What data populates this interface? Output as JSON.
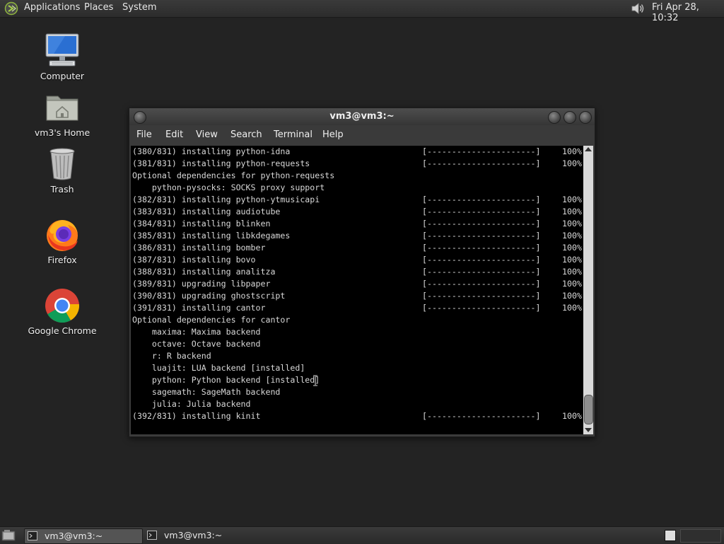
{
  "top_panel": {
    "menus": [
      "Applications",
      "Places",
      "System"
    ],
    "clock": "Fri Apr 28, 10:32"
  },
  "desktop_icons": [
    {
      "label": "Computer",
      "icon": "computer-icon"
    },
    {
      "label": "vm3's Home",
      "icon": "home-folder-icon"
    },
    {
      "label": "Trash",
      "icon": "trash-icon"
    },
    {
      "label": "Firefox",
      "icon": "firefox-icon"
    },
    {
      "label": "Google Chrome",
      "icon": "chrome-icon"
    }
  ],
  "terminal": {
    "title": "vm3@vm3:~",
    "menu": [
      "File",
      "Edit",
      "View",
      "Search",
      "Terminal",
      "Help"
    ],
    "lines": [
      {
        "text": "(380/831) installing python-idna",
        "bar": "[----------------------]",
        "pct": "100%"
      },
      {
        "text": "(381/831) installing python-requests",
        "bar": "[----------------------]",
        "pct": "100%"
      },
      {
        "text": "Optional dependencies for python-requests",
        "bar": "",
        "pct": ""
      },
      {
        "text": "    python-pysocks: SOCKS proxy support",
        "bar": "",
        "pct": ""
      },
      {
        "text": "(382/831) installing python-ytmusicapi",
        "bar": "[----------------------]",
        "pct": "100%"
      },
      {
        "text": "(383/831) installing audiotube",
        "bar": "[----------------------]",
        "pct": "100%"
      },
      {
        "text": "(384/831) installing blinken",
        "bar": "[----------------------]",
        "pct": "100%"
      },
      {
        "text": "(385/831) installing libkdegames",
        "bar": "[----------------------]",
        "pct": "100%"
      },
      {
        "text": "(386/831) installing bomber",
        "bar": "[----------------------]",
        "pct": "100%"
      },
      {
        "text": "(387/831) installing bovo",
        "bar": "[----------------------]",
        "pct": "100%"
      },
      {
        "text": "(388/831) installing analitza",
        "bar": "[----------------------]",
        "pct": "100%"
      },
      {
        "text": "(389/831) upgrading libpaper",
        "bar": "[----------------------]",
        "pct": "100%"
      },
      {
        "text": "(390/831) upgrading ghostscript",
        "bar": "[----------------------]",
        "pct": "100%"
      },
      {
        "text": "(391/831) installing cantor",
        "bar": "[----------------------]",
        "pct": "100%"
      },
      {
        "text": "Optional dependencies for cantor",
        "bar": "",
        "pct": ""
      },
      {
        "text": "    maxima: Maxima backend",
        "bar": "",
        "pct": ""
      },
      {
        "text": "    octave: Octave backend",
        "bar": "",
        "pct": ""
      },
      {
        "text": "    r: R backend",
        "bar": "",
        "pct": ""
      },
      {
        "text": "    luajit: LUA backend [installed]",
        "bar": "",
        "pct": ""
      },
      {
        "text": "    python: Python backend [installed]",
        "bar": "",
        "pct": ""
      },
      {
        "text": "    sagemath: SageMath backend",
        "bar": "",
        "pct": ""
      },
      {
        "text": "    julia: Julia backend",
        "bar": "",
        "pct": ""
      },
      {
        "text": "(392/831) installing kinit",
        "bar": "[----------------------]",
        "pct": "100%"
      }
    ]
  },
  "taskbar": {
    "tasks": [
      "vm3@vm3:~",
      "vm3@vm3:~"
    ]
  }
}
